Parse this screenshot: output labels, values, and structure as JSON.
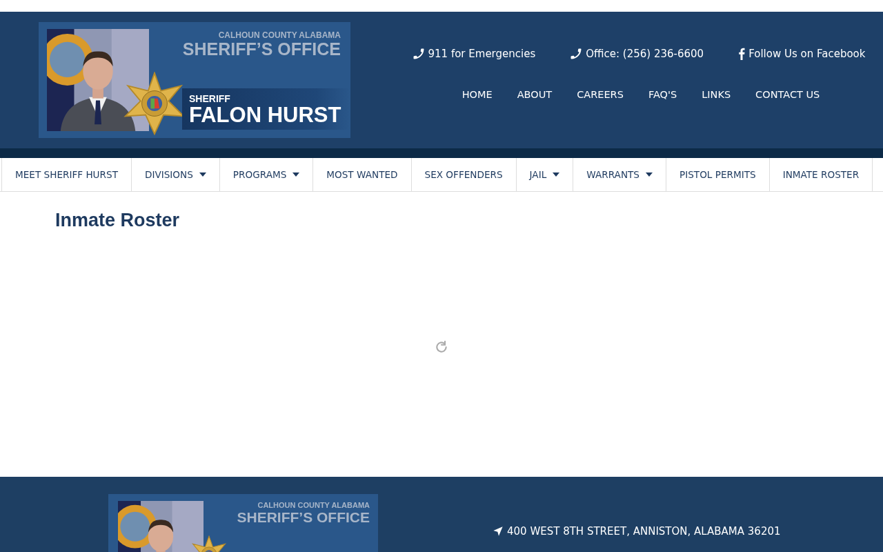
{
  "header": {
    "logo": {
      "county": "CALHOUN COUNTY ALABAMA",
      "office": "SHERIFF’S OFFICE",
      "rank": "SHERIFF",
      "name": "FALON HURST"
    },
    "contacts": [
      {
        "kind": "phone",
        "text": "911 for Emergencies"
      },
      {
        "kind": "phone",
        "text": "Office: (256) 236-6600"
      },
      {
        "kind": "facebook",
        "text": "Follow Us on Facebook"
      }
    ],
    "top_nav": [
      "HOME",
      "ABOUT",
      "CAREERS",
      "FAQ'S",
      "LINKS",
      "CONTACT US"
    ]
  },
  "main_nav": [
    {
      "label": "MEET SHERIFF HURST",
      "dropdown": false
    },
    {
      "label": "DIVISIONS",
      "dropdown": true
    },
    {
      "label": "PROGRAMS",
      "dropdown": true
    },
    {
      "label": "MOST WANTED",
      "dropdown": false
    },
    {
      "label": "SEX OFFENDERS",
      "dropdown": false
    },
    {
      "label": "JAIL",
      "dropdown": true
    },
    {
      "label": "WARRANTS",
      "dropdown": true
    },
    {
      "label": "PISTOL PERMITS",
      "dropdown": false
    },
    {
      "label": "INMATE ROSTER",
      "dropdown": false
    }
  ],
  "page": {
    "title": "Inmate Roster",
    "loading": true
  },
  "footer": {
    "logo": {
      "county": "CALHOUN COUNTY ALABAMA",
      "office": "SHERIFF’S OFFICE"
    },
    "address": "400 WEST 8TH STREET, ANNISTON, ALABAMA 36201"
  }
}
